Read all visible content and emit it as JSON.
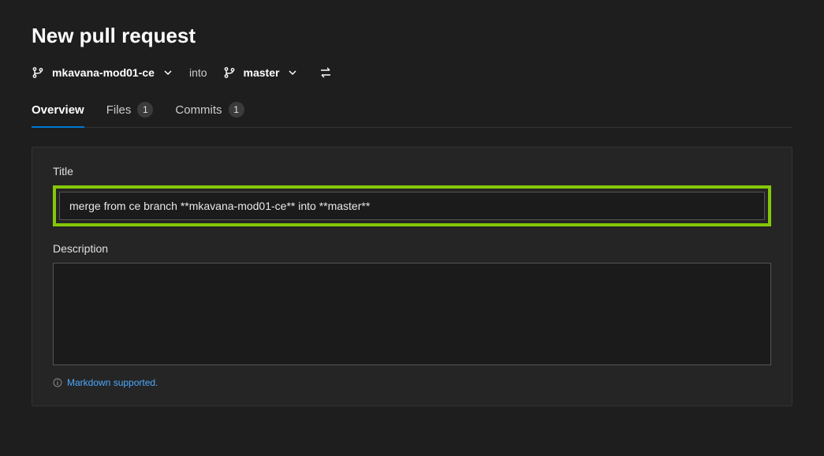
{
  "page": {
    "title": "New pull request"
  },
  "branches": {
    "source": "mkavana-mod01-ce",
    "into_label": "into",
    "target": "master"
  },
  "tabs": {
    "overview": {
      "label": "Overview"
    },
    "files": {
      "label": "Files",
      "count": "1"
    },
    "commits": {
      "label": "Commits",
      "count": "1"
    }
  },
  "form": {
    "title_label": "Title",
    "title_value": "merge from ce branch **mkavana-mod01-ce** into **master**",
    "description_label": "Description",
    "description_value": "",
    "markdown_hint": "Markdown supported."
  }
}
